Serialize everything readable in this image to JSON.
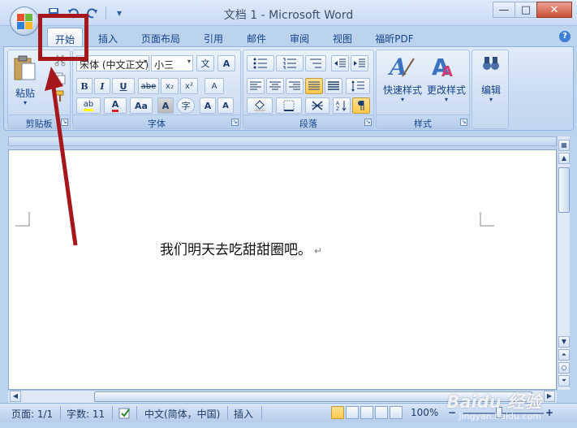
{
  "window": {
    "title": "文档 1 - Microsoft Word",
    "controls": {
      "minimize": "—",
      "maximize": "□",
      "close": "✕"
    }
  },
  "quick_access": {
    "save_icon": "save-icon",
    "undo_icon": "undo-icon",
    "redo_icon": "redo-icon",
    "customize": "▾"
  },
  "tabs": [
    {
      "label": "开始",
      "active": true
    },
    {
      "label": "插入"
    },
    {
      "label": "页面布局"
    },
    {
      "label": "引用"
    },
    {
      "label": "邮件"
    },
    {
      "label": "审阅"
    },
    {
      "label": "视图"
    },
    {
      "label": "福昕PDF"
    }
  ],
  "help": "?",
  "ribbon": {
    "clipboard": {
      "label": "剪贴板",
      "paste_label": "粘贴",
      "paste_arrow": "▾"
    },
    "font": {
      "label": "字体",
      "font_name": "宋体 (中文正文)",
      "font_size": "小三",
      "pinyin_glyph": "文",
      "border_glyph": "A",
      "clear_glyph": "A",
      "bold": "B",
      "italic": "I",
      "underline": "U",
      "strike": "abe",
      "subscript": "x₂",
      "superscript": "x²",
      "highlight": "ab",
      "font_color": "A",
      "case": "Aa",
      "shade": "A",
      "enclose": "字",
      "grow": "A",
      "shrink": "A"
    },
    "paragraph": {
      "label": "段落"
    },
    "styles": {
      "label": "样式",
      "quick_styles": "快速样式",
      "change_styles": "更改样式"
    },
    "editing": {
      "label": "编辑"
    }
  },
  "document": {
    "text": "我们明天去吃甜甜圈吧。",
    "paragraph_mark": "↵"
  },
  "statusbar": {
    "page": "页面: 1/1",
    "words": "字数: 11",
    "language": "中文(简体，中国)",
    "mode": "插入",
    "zoom": "100%",
    "zoom_level": 1.0,
    "zoom_minus": "−",
    "zoom_plus": "+"
  },
  "watermark": {
    "brand": "Baidu 经验",
    "url": "jingyan.baidu.com"
  },
  "colors": {
    "annotation": "#a6171c",
    "font_color_bar": "#e02020",
    "highlight_bar": "#ffff00",
    "active_button": "#ffc74d"
  }
}
